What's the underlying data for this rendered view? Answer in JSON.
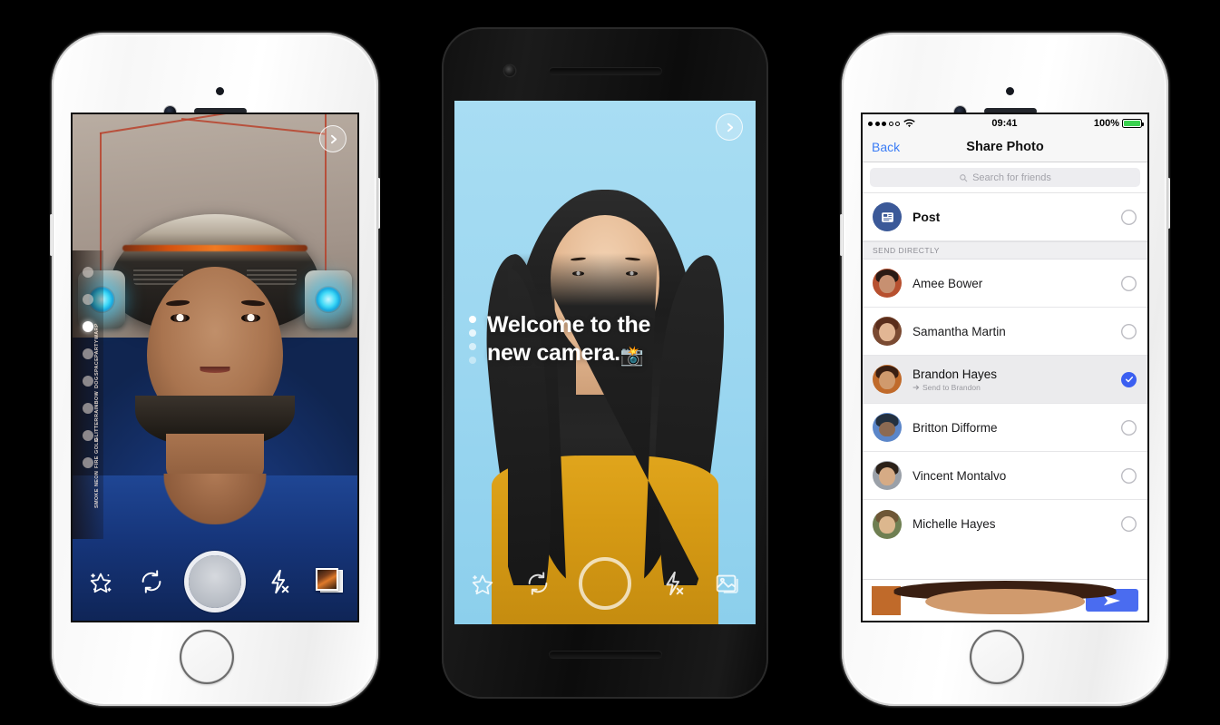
{
  "scene": {
    "background": "#000000",
    "devices": [
      {
        "name": "iphone-left",
        "type": "white-iphone"
      },
      {
        "name": "android-center",
        "type": "black-android"
      },
      {
        "name": "iphone-right",
        "type": "white-iphone"
      }
    ]
  },
  "screen_left": {
    "name": "ar-camera-effect",
    "next_button_icon": "chevron-right-icon",
    "effects_rail": {
      "label": "effects-carousel",
      "items": [
        "WARP",
        "PARTY",
        "SPACE",
        "DOG",
        "RAINBOW",
        "GLITTER",
        "GOLD",
        "FIRE",
        "NEON",
        "SMOKE"
      ],
      "active_index": 2
    },
    "toolbar": [
      {
        "name": "effects-button",
        "icon": "magic-star-icon"
      },
      {
        "name": "flip-camera-button",
        "icon": "flip-camera-icon"
      },
      {
        "name": "shutter-button",
        "icon": "shutter-solid-icon"
      },
      {
        "name": "flash-button",
        "icon": "flash-off-icon"
      },
      {
        "name": "gallery-button",
        "icon": "photo-stack-icon"
      }
    ]
  },
  "screen_center": {
    "name": "camera-welcome",
    "next_button_icon": "chevron-right-icon",
    "headline_line1": "Welcome to the",
    "headline_line2": "new camera.",
    "headline_emoji": "📸",
    "pager_dots": 4,
    "toolbar": [
      {
        "name": "effects-button",
        "icon": "magic-star-icon"
      },
      {
        "name": "flip-camera-button",
        "icon": "flip-camera-icon"
      },
      {
        "name": "shutter-button",
        "icon": "shutter-ring-icon"
      },
      {
        "name": "flash-button",
        "icon": "flash-off-icon"
      },
      {
        "name": "gallery-button",
        "icon": "photo-frame-icon"
      }
    ]
  },
  "screen_right": {
    "name": "share-photo",
    "statusbar": {
      "signal_filled": 3,
      "signal_empty": 2,
      "wifi_icon": "wifi-icon",
      "time": "09:41",
      "battery_percent": "100%",
      "battery_color": "#3ad14f"
    },
    "navbar": {
      "back_label": "Back",
      "title": "Share Photo",
      "back_color": "#3b7df6"
    },
    "search": {
      "placeholder": "Search for friends",
      "icon": "search-icon"
    },
    "post_row": {
      "label": "Post",
      "icon": "news-feed-icon",
      "icon_bg": "#3b5998",
      "selected": false
    },
    "section_header": "SEND DIRECTLY",
    "contacts": [
      {
        "name": "Amee Bower",
        "selected": false,
        "subtitle": "",
        "avatar_hair": "#2a1a14",
        "avatar_skin": "#c79071"
      },
      {
        "name": "Samantha Martin",
        "selected": false,
        "subtitle": "",
        "avatar_hair": "#5a2d1b",
        "avatar_skin": "#e2b694"
      },
      {
        "name": "Brandon Hayes",
        "selected": true,
        "subtitle": "Send to Brandon",
        "subtitle_icon": "arrow-send-icon",
        "avatar_hair": "#3a1f12",
        "avatar_skin": "#d09a6d"
      },
      {
        "name": "Britton Difforme",
        "selected": false,
        "subtitle": "",
        "avatar_hair": "#23303f",
        "avatar_skin": "#8c6a52"
      },
      {
        "name": "Vincent Montalvo",
        "selected": false,
        "subtitle": "",
        "avatar_hair": "#2b2119",
        "avatar_skin": "#d6ab85"
      },
      {
        "name": "Michelle Hayes",
        "selected": false,
        "subtitle": "",
        "avatar_hair": "#6e5736",
        "avatar_skin": "#dcb78e"
      }
    ],
    "bottom_bar": {
      "avatar_name": "composer-avatar",
      "send_button_icon": "paper-plane-icon",
      "send_button_color": "#4a6cf0"
    },
    "selected_color": "#3b5ff1"
  }
}
